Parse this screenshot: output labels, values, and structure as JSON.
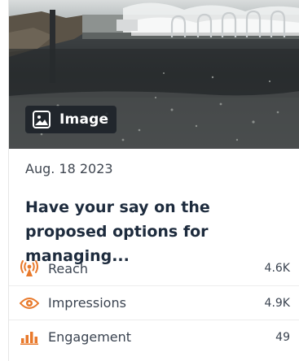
{
  "card": {
    "media_badge_label": "Image",
    "date": "Aug. 18 2023",
    "title": "Have your say on the proposed options for managing...",
    "metrics": [
      {
        "label": "Reach",
        "value": "4.6K",
        "icon": "broadcast-icon"
      },
      {
        "label": "Impressions",
        "value": "4.9K",
        "icon": "eye-icon"
      },
      {
        "label": "Engagement",
        "value": "49",
        "icon": "bar-chart-icon"
      }
    ]
  },
  "colors": {
    "accent": "#e8792b",
    "title": "#1d2b3d",
    "text": "#3a4350"
  }
}
